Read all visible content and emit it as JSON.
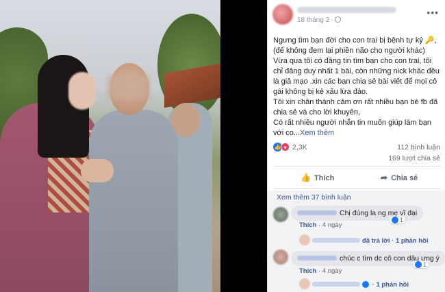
{
  "post": {
    "time": "18 tháng 2",
    "body_text": "Ngưng tìm bạn đời cho con trai bị bệnh tự kỷ 🔑,\n(để không đem lại phiền não cho người khác)\nVừa qua tôi có đăng tin tìm bạn cho con trai, tôi chỉ đăng duy nhất 1 bài, còn những nick khác đều là giả mạo .xin các bạn chia sẻ bài viết để mọi cô gái không bị kẻ xấu lừa đảo.\nTôi xin chân thành cảm ơn rất nhiều bạn bè fb đã chia sẻ và cho lời khuyên,\nCó rất nhiều người nhắn tin muốn giúp làm bạn với co...",
    "see_more": "Xem thêm",
    "reactions_count": "2,3K",
    "comments_count": "112 bình luận",
    "shares_count": "169 lượt chia sẻ",
    "like_label": "Thích",
    "share_label": "Chia sẻ"
  },
  "comments": {
    "view_more": "Xem thêm 37 bình luận",
    "items": [
      {
        "text": "Chị đúng la ng mẹ vĩ đại",
        "like": "Thích",
        "time": "4 ngày",
        "reaction_count": "1",
        "reply_link": "đã trả lời",
        "reply_count": "1 phản hồi"
      },
      {
        "text": "chúc c tìm dc cô con dâu ưng ý",
        "like": "Thích",
        "time": "4 ngày",
        "reaction_count": "1",
        "reply_count": "1 phản hồi"
      }
    ]
  },
  "colors": {
    "link": "#385898",
    "like_blue": "#1877f2",
    "love_red": "#f33e58"
  }
}
